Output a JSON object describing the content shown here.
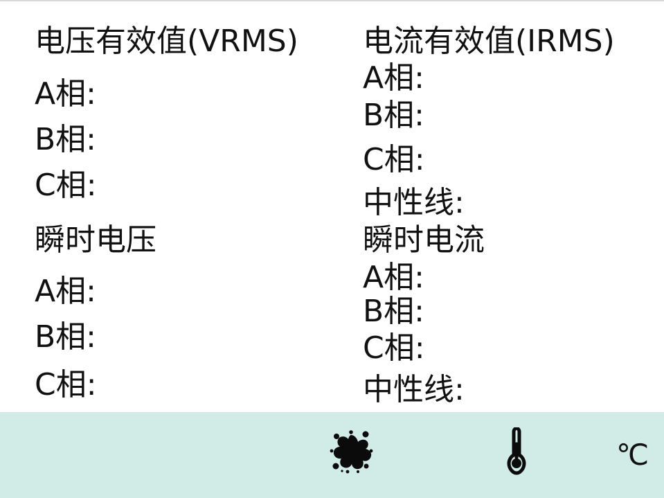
{
  "left": {
    "rms_title": "电压有效值(VRMS)",
    "rms_rows": [
      "A相:",
      "B相:",
      "C相:"
    ],
    "inst_title": "瞬时电压",
    "inst_rows": [
      "A相:",
      "B相:",
      "C相:"
    ]
  },
  "right": {
    "rms_title": "电流有效值(IRMS)",
    "rms_rows": [
      "A相:",
      "B相:",
      "C相:",
      "中性线:"
    ],
    "inst_title": "瞬时电流",
    "inst_rows": [
      "A相:",
      "B相:",
      "C相:",
      "中性线:"
    ]
  },
  "footer": {
    "background": "#d1ebe6",
    "icons": [
      "ink-splat-icon",
      "thermometer-icon"
    ],
    "temp_unit": "℃"
  }
}
